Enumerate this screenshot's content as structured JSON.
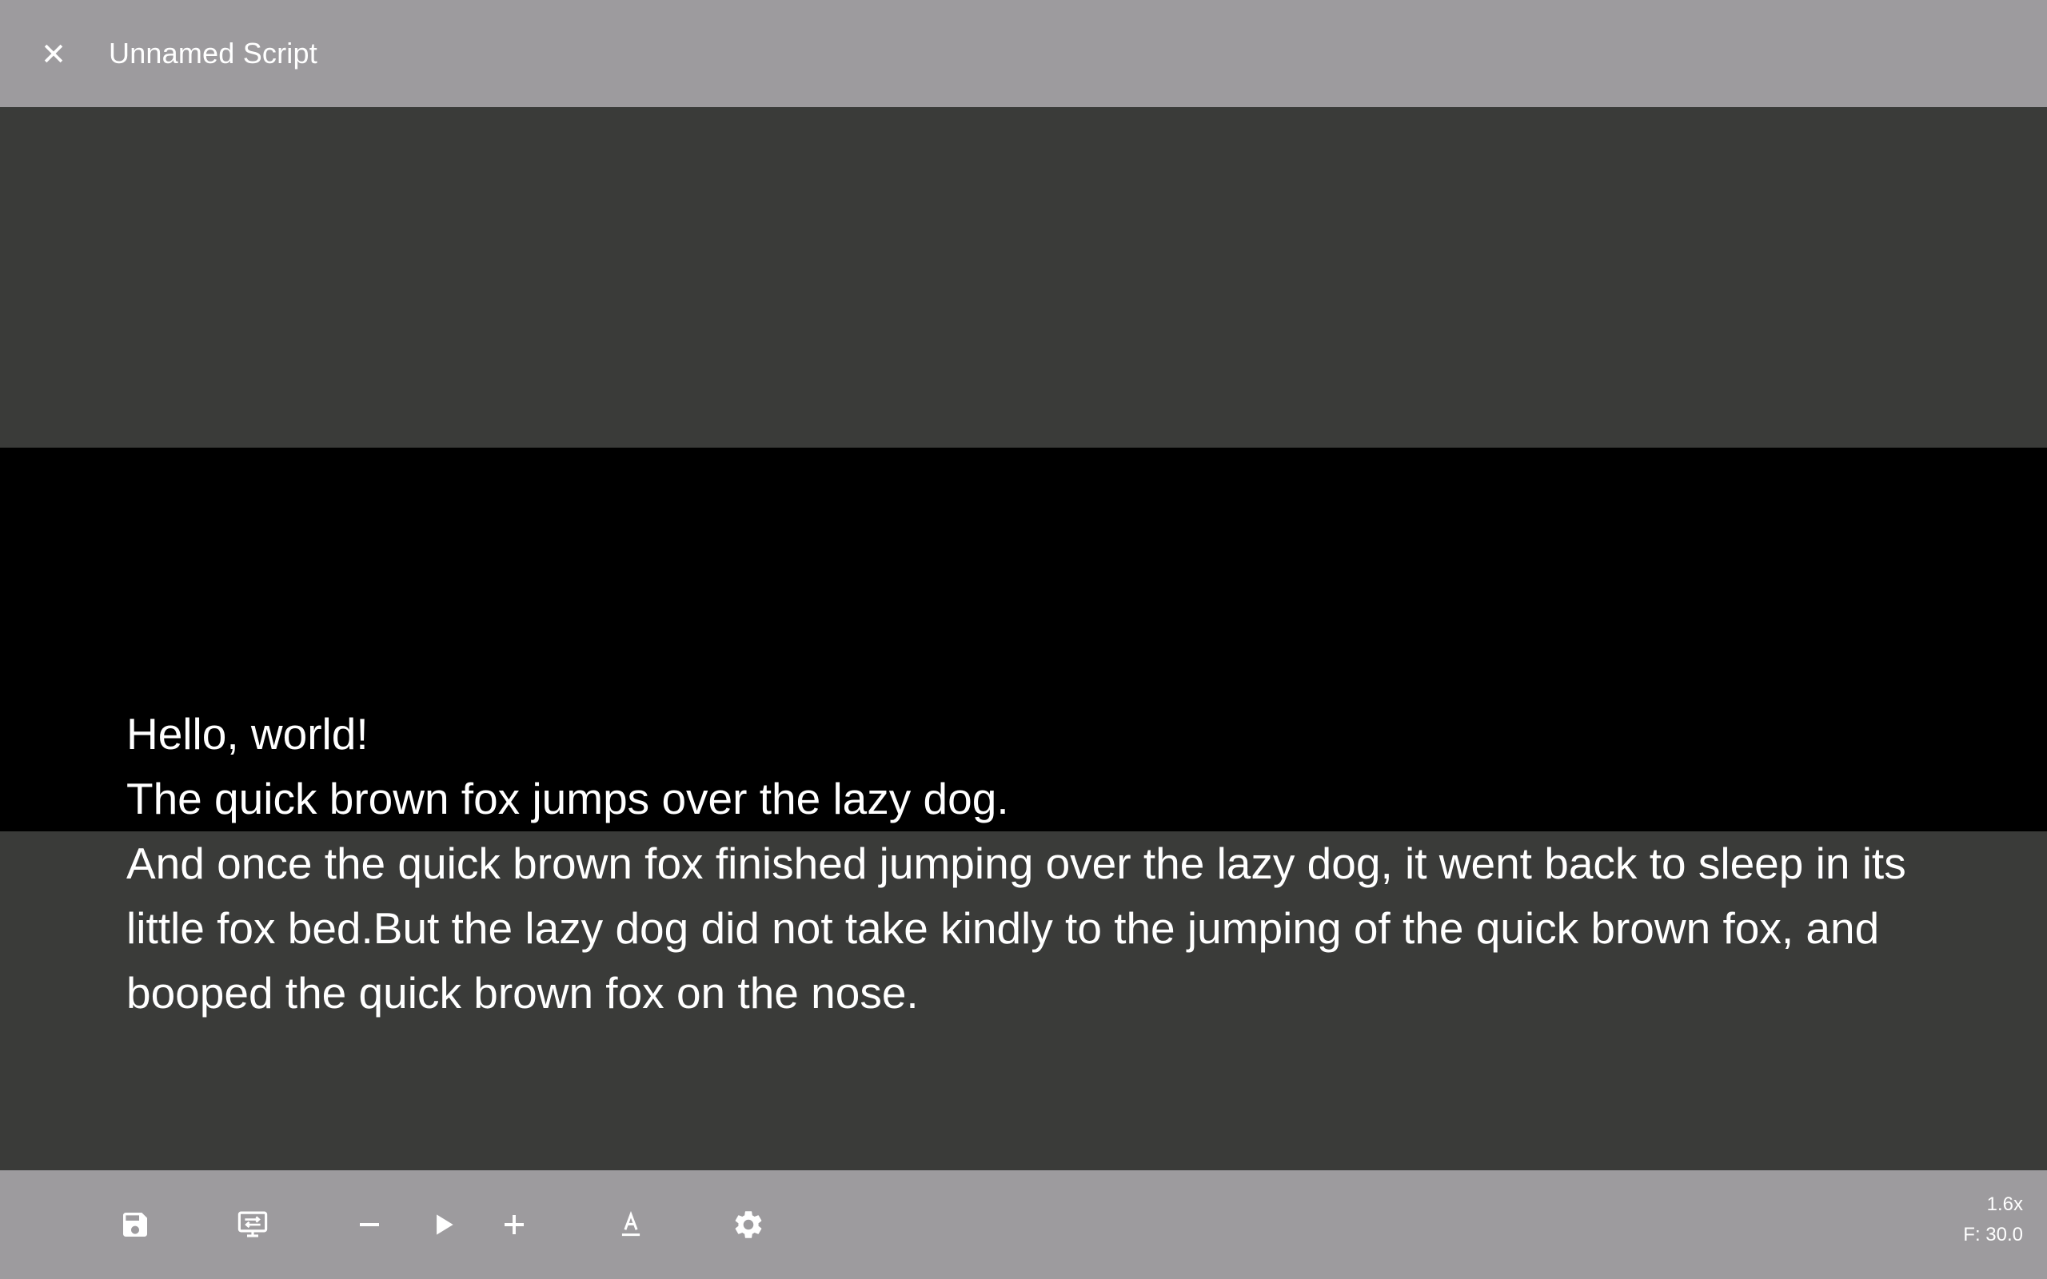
{
  "header": {
    "title": "Unnamed Script",
    "close_icon": "close-icon"
  },
  "script": {
    "lines": [
      "Hello, world!",
      "The quick brown fox jumps over the lazy dog.",
      "And once the quick brown fox finished jumping over the lazy dog, it went back to sleep in its little fox bed.But the lazy dog did not take kindly to the jumping of the quick brown fox, and booped the quick brown fox on the nose."
    ]
  },
  "toolbar": {
    "icons": [
      "save-icon",
      "mirror-display-icon",
      "minus-icon",
      "play-icon",
      "plus-icon",
      "text-format-icon",
      "gear-icon"
    ],
    "speed": "1.6x",
    "font_size": "F: 30.0"
  },
  "colors": {
    "bars": "#9d9b9e",
    "background": "#3a3b39",
    "focus_band": "#000000",
    "text": "#ffffff"
  }
}
